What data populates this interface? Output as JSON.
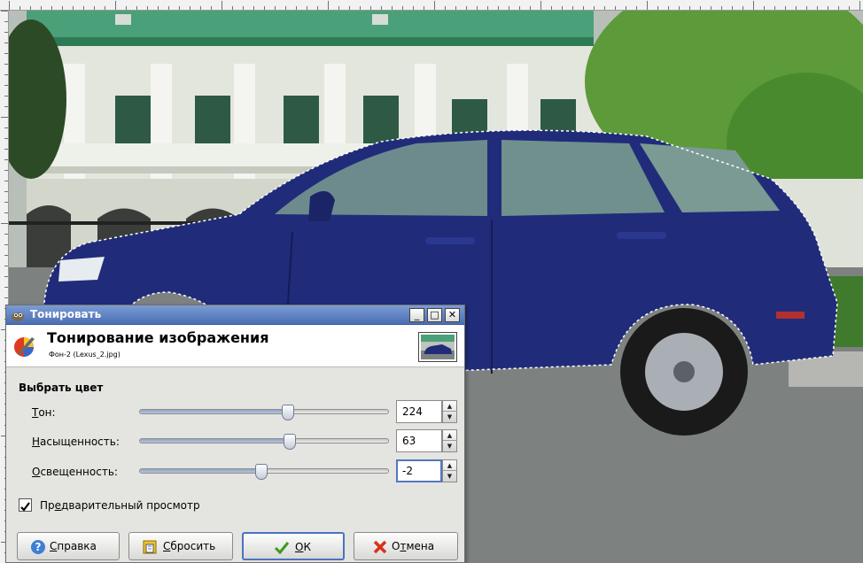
{
  "dialog": {
    "title": "Тонировать",
    "minimize": "_",
    "maximize": "□",
    "close": "✕",
    "header_title": "Тонирование изображения",
    "header_subtitle": "Фон-2 (Lexus_2.jpg)",
    "section_label": "Выбрать цвет",
    "rows": [
      {
        "label_u": "Т",
        "label_rest": "он:",
        "value": "224",
        "fraction": 0.6
      },
      {
        "label_u": "Н",
        "label_rest": "асыщенность:",
        "value": "63",
        "fraction": 0.61
      },
      {
        "label_u": "О",
        "label_rest": "свещенность:",
        "value": "-2",
        "fraction": 0.49
      }
    ],
    "preview_label_pre": "Пр",
    "preview_label_u": "е",
    "preview_label_post": "дварительный просмотр",
    "preview_checked": true,
    "buttons": {
      "help_u": "С",
      "help_rest": "правка",
      "reset_u": "С",
      "reset_rest": "бросить",
      "ok_u": "О",
      "ok_rest": "К",
      "cancel_pre": "О",
      "cancel_u": "т",
      "cancel_post": "мена"
    }
  },
  "colors": {
    "titlebar": "#4a6fb4",
    "car": "#1f2c78",
    "building": "#e8ebe3",
    "roof": "#3e9a6c"
  }
}
